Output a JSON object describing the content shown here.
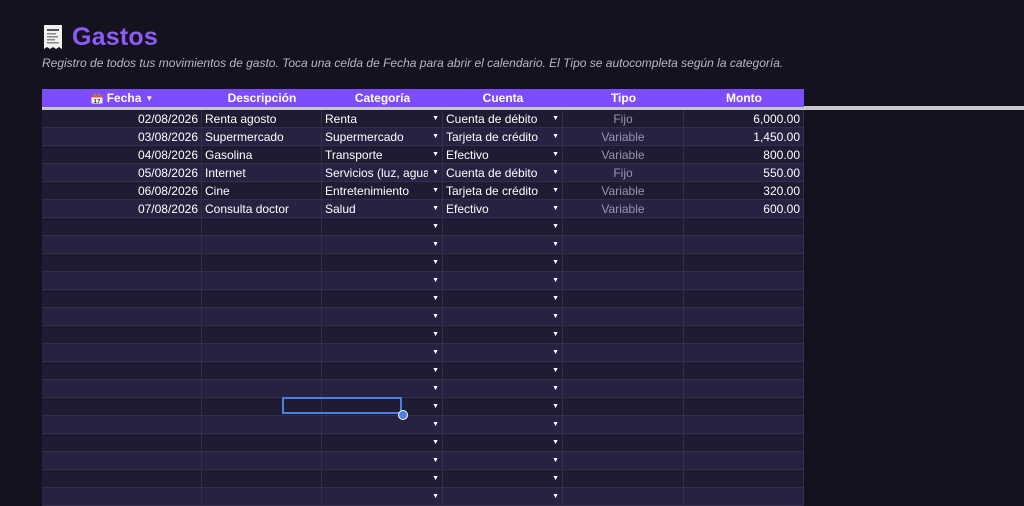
{
  "page": {
    "title": "Gastos",
    "subtitle": "Registro de todos tus movimientos de gasto. Toca una celda de Fecha para abrir el calendario. El Tipo se autocompleta según la categoría."
  },
  "colors": {
    "accent": "#8b5cf6",
    "header_bg": "#7c4dff",
    "selection": "#4a7fe8"
  },
  "table": {
    "headers": {
      "fecha": "Fecha",
      "descripcion": "Descripción",
      "categoria": "Categoría",
      "cuenta": "Cuenta",
      "tipo": "Tipo",
      "monto": "Monto"
    },
    "rows": [
      {
        "fecha": "02/08/2026",
        "descripcion": "Renta agosto",
        "categoria": "Renta",
        "cuenta": "Cuenta de débito",
        "tipo": "Fijo",
        "monto": "6,000.00"
      },
      {
        "fecha": "03/08/2026",
        "descripcion": "Supermercado",
        "categoria": "Supermercado",
        "cuenta": "Tarjeta de crédito",
        "tipo": "Variable",
        "monto": "1,450.00"
      },
      {
        "fecha": "04/08/2026",
        "descripcion": "Gasolina",
        "categoria": "Transporte",
        "cuenta": "Efectivo",
        "tipo": "Variable",
        "monto": "800.00"
      },
      {
        "fecha": "05/08/2026",
        "descripcion": "Internet",
        "categoria": "Servicios (luz, agua,",
        "cuenta": "Cuenta de débito",
        "tipo": "Fijo",
        "monto": "550.00"
      },
      {
        "fecha": "06/08/2026",
        "descripcion": "Cine",
        "categoria": "Entretenimiento",
        "cuenta": "Tarjeta de crédito",
        "tipo": "Variable",
        "monto": "320.00"
      },
      {
        "fecha": "07/08/2026",
        "descripcion": "Consulta doctor",
        "categoria": "Salud",
        "cuenta": "Efectivo",
        "tipo": "Variable",
        "monto": "600.00"
      }
    ],
    "empty_rows": 16
  },
  "icons": {
    "title": "receipt-icon",
    "fecha_header": "calendar-icon",
    "sort": "sort-down-icon",
    "dropdown": "dropdown-arrow-icon"
  }
}
